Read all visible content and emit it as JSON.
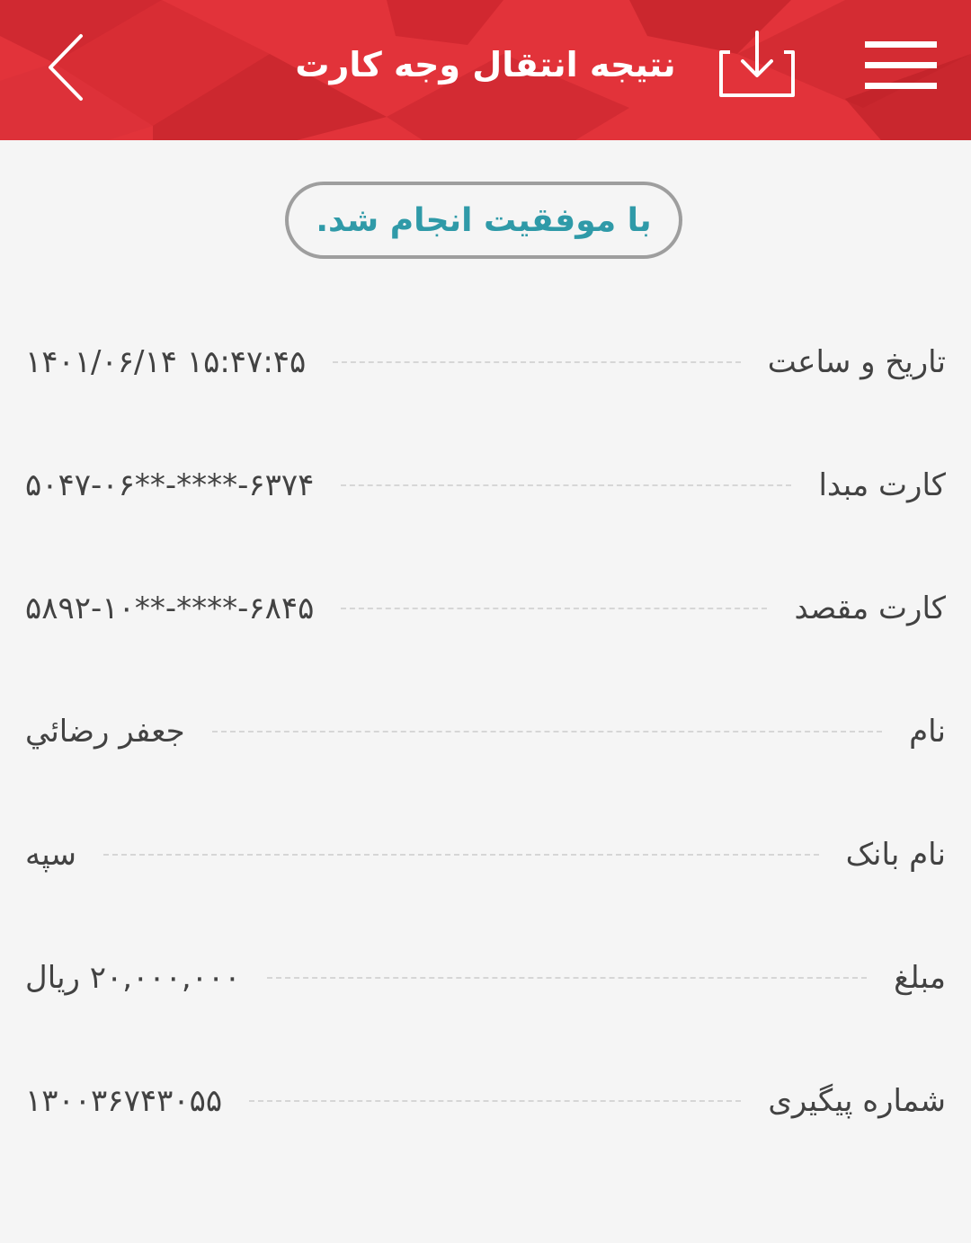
{
  "header": {
    "title": "نتیجه انتقال وجه کارت",
    "back_icon": "chevron-left-icon",
    "download_icon": "download-icon",
    "menu_icon": "hamburger-menu-icon",
    "background_color": "#e2333a"
  },
  "status": {
    "message": "با موفقیت انجام شد.",
    "color": "#2f9aa8"
  },
  "details": [
    {
      "label": "تاریخ و ساعت",
      "value": "۱۴۰۱/۰۶/۱۴ ۱۵:۴۷:۴۵"
    },
    {
      "label": "کارت مبدا",
      "value": "۵۰۴۷-۰۶**-****-۶۳۷۴"
    },
    {
      "label": "کارت مقصد",
      "value": "۵۸۹۲-۱۰**-****-۶۸۴۵"
    },
    {
      "label": "نام",
      "value": "جعفر رضائي"
    },
    {
      "label": "نام بانک",
      "value": "سپه"
    },
    {
      "label": "مبلغ",
      "value": "۲۰,۰۰۰,۰۰۰ ریال"
    },
    {
      "label": "شماره پیگیری",
      "value": "۱۳۰۰۳۶۷۴۳۰۵۵"
    }
  ]
}
